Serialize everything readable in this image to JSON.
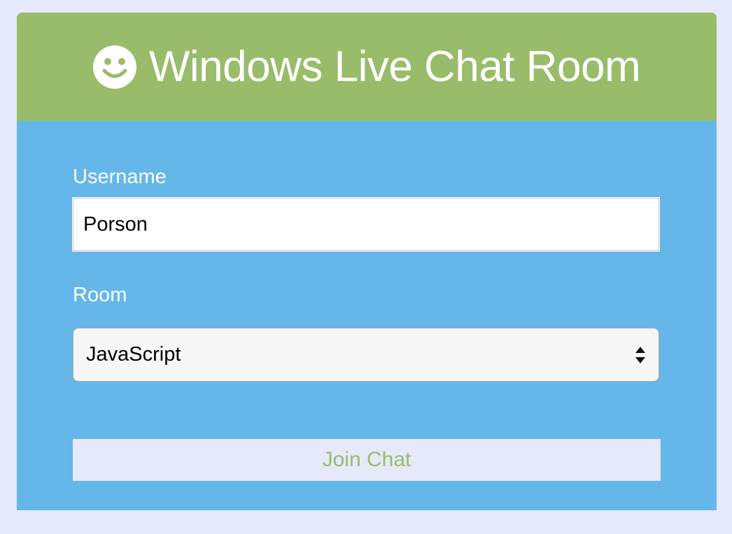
{
  "header": {
    "icon": "smiley-icon",
    "title": "Windows Live Chat Room"
  },
  "form": {
    "username_label": "Username",
    "username_value": "Porson",
    "room_label": "Room",
    "room_selected": "JavaScript",
    "join_label": "Join Chat"
  },
  "colors": {
    "page_background": "#e6e9fa",
    "header_background": "#98bc69",
    "form_background": "#64b7e8",
    "button_text": "#98bc69"
  }
}
